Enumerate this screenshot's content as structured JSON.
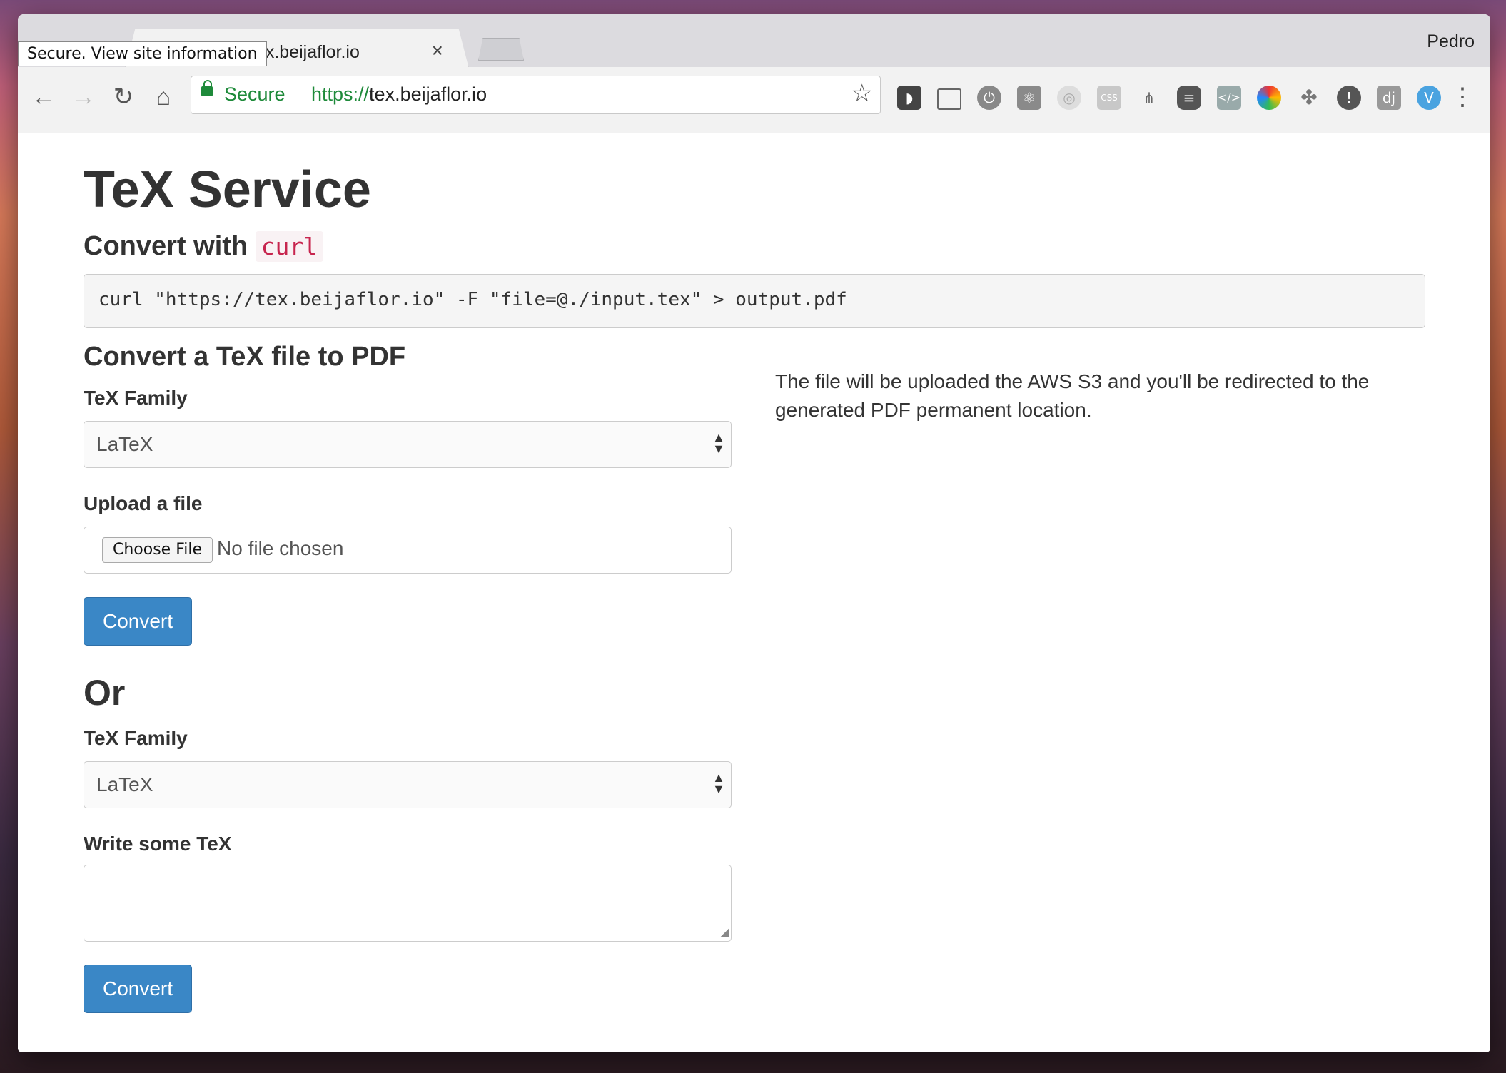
{
  "browser": {
    "tooltip": "Secure. View site information",
    "tab_title": "tex.beijaflor.io",
    "tab_close": "×",
    "profile": "Pedro",
    "security_label": "Secure",
    "url_scheme": "https://",
    "url_host": "tex.beijaflor.io",
    "nav_back": "←",
    "nav_forward": "→",
    "nav_reload": "↻",
    "nav_home": "⌂",
    "bookmark_star": "☆",
    "menu": "⋮"
  },
  "page": {
    "title": "TeX Service",
    "curl_heading": "Convert with",
    "curl_code": "curl",
    "curl_command": "curl \"https://tex.beijaflor.io\" -F \"file=@./input.tex\" > output.pdf",
    "convert_heading": "Convert a TeX file to PDF",
    "family_label_1": "TeX Family",
    "family_value_1": "LaTeX",
    "upload_label": "Upload a file",
    "choose_file": "Choose File",
    "no_file": "No file chosen",
    "convert_1": "Convert",
    "or_heading": "Or",
    "family_label_2": "TeX Family",
    "family_value_2": "LaTeX",
    "write_label": "Write some TeX",
    "convert_2": "Convert",
    "help_text": "The file will be uploaded the AWS S3 and you'll be redirected to the generated PDF permanent location."
  },
  "colors": {
    "primary_button": "#3a87c6",
    "secure_green": "#1e8a3a",
    "code_red": "#c7254e"
  }
}
